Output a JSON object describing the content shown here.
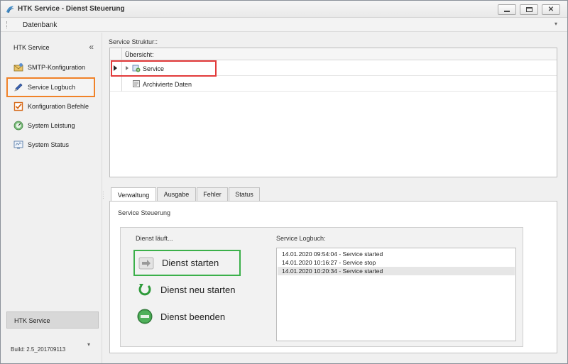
{
  "window": {
    "title": "HTK Service - Dienst Steuerung",
    "minimize_icon": "minimize-icon",
    "maximize_icon": "maximize-icon",
    "close_icon": "close-icon"
  },
  "menubar": {
    "item": "Datenbank"
  },
  "sidebar": {
    "header": "HTK Service",
    "collapse_glyph": "«",
    "items": [
      {
        "label": "SMTP-Konfiguration",
        "icon": "mail-settings-icon"
      },
      {
        "label": "Service Logbuch",
        "icon": "pen-icon"
      },
      {
        "label": "Konfiguration Befehle",
        "icon": "checkbox-icon"
      },
      {
        "label": "System Leistung",
        "icon": "gauge-icon"
      },
      {
        "label": "System Status",
        "icon": "monitor-icon"
      }
    ],
    "footer_button": "HTK Service",
    "build": "Build: 2.5_201709113"
  },
  "structure": {
    "title": "Service Struktur::",
    "column_header": "Übersicht:",
    "rows": [
      {
        "label": "Service",
        "icon": "service-icon"
      },
      {
        "label": "Archivierte Daten",
        "icon": "archive-icon"
      }
    ]
  },
  "tabs": [
    "Verwaltung",
    "Ausgabe",
    "Fehler",
    "Status"
  ],
  "control": {
    "title": "Service Steuerung",
    "status": "Dienst läuft...",
    "buttons": [
      {
        "label": "Dienst starten",
        "icon": "arrow-right-icon"
      },
      {
        "label": "Dienst neu starten",
        "icon": "restart-icon"
      },
      {
        "label": "Dienst beenden",
        "icon": "stop-icon"
      }
    ],
    "log_title": "Service Logbuch:",
    "log_entries": [
      "14.01.2020 09:54:04 - Service started",
      "14.01.2020 10:16:27 - Service stop",
      "14.01.2020 10:20:34 - Service started"
    ]
  },
  "colors": {
    "highlight_orange": "#f08228",
    "highlight_red": "#e23a3a",
    "highlight_green": "#3bb04a"
  }
}
